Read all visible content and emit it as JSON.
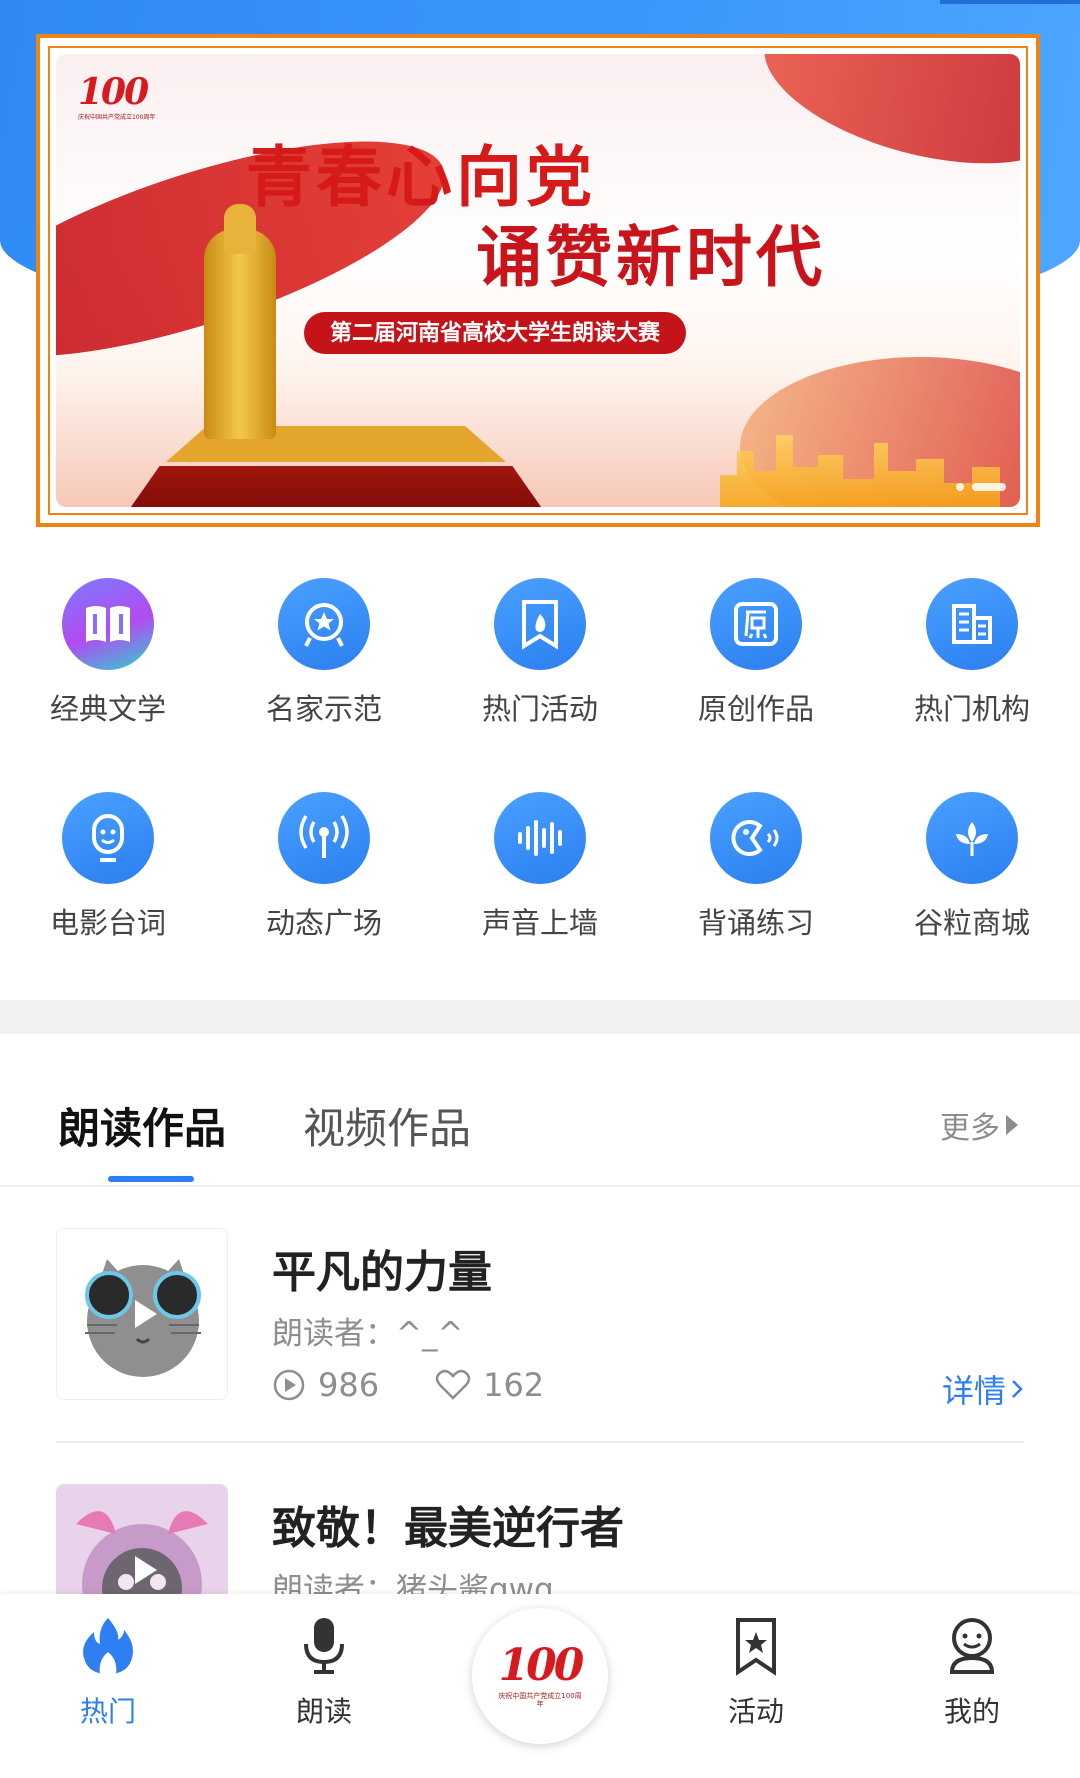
{
  "banner": {
    "logo_number": "100",
    "logo_caption": "庆祝中国共产党成立100周年",
    "title_line1": "青春心向党",
    "title_line2": "诵赞新时代",
    "subtitle": "第二届河南省高校大学生朗读大赛"
  },
  "categories": [
    {
      "label": "经典文学",
      "icon": "book-icon"
    },
    {
      "label": "名家示范",
      "icon": "star-badge-icon"
    },
    {
      "label": "热门活动",
      "icon": "flame-bookmark-icon"
    },
    {
      "label": "原创作品",
      "icon": "original-icon"
    },
    {
      "label": "热门机构",
      "icon": "building-icon"
    },
    {
      "label": "电影台词",
      "icon": "face-icon"
    },
    {
      "label": "动态广场",
      "icon": "broadcast-icon"
    },
    {
      "label": "声音上墙",
      "icon": "soundwave-icon"
    },
    {
      "label": "背诵练习",
      "icon": "recite-icon"
    },
    {
      "label": "谷粒商城",
      "icon": "grain-icon"
    }
  ],
  "tabs": {
    "active": "朗读作品",
    "inactive": "视频作品",
    "more": "更多"
  },
  "works": [
    {
      "title": "平凡的力量",
      "reader": "朗读者：^_^",
      "plays": "986",
      "likes": "162",
      "details": "详情"
    },
    {
      "title": "致敬！最美逆行者",
      "reader": "朗读者：猪头酱qwq."
    }
  ],
  "bottom_nav": [
    {
      "label": "热门",
      "icon": "flame-icon",
      "active": true
    },
    {
      "label": "朗读",
      "icon": "microphone-icon"
    },
    {
      "label": "活动",
      "icon": "bookmark-star-icon"
    },
    {
      "label": "我的",
      "icon": "user-icon"
    }
  ],
  "center_logo": {
    "number": "100",
    "caption": "庆祝中国共产党成立100周年"
  },
  "colors": {
    "accent": "#2e7ff1",
    "banner_red": "#d61a1a",
    "highlight_border": "#f08312"
  }
}
